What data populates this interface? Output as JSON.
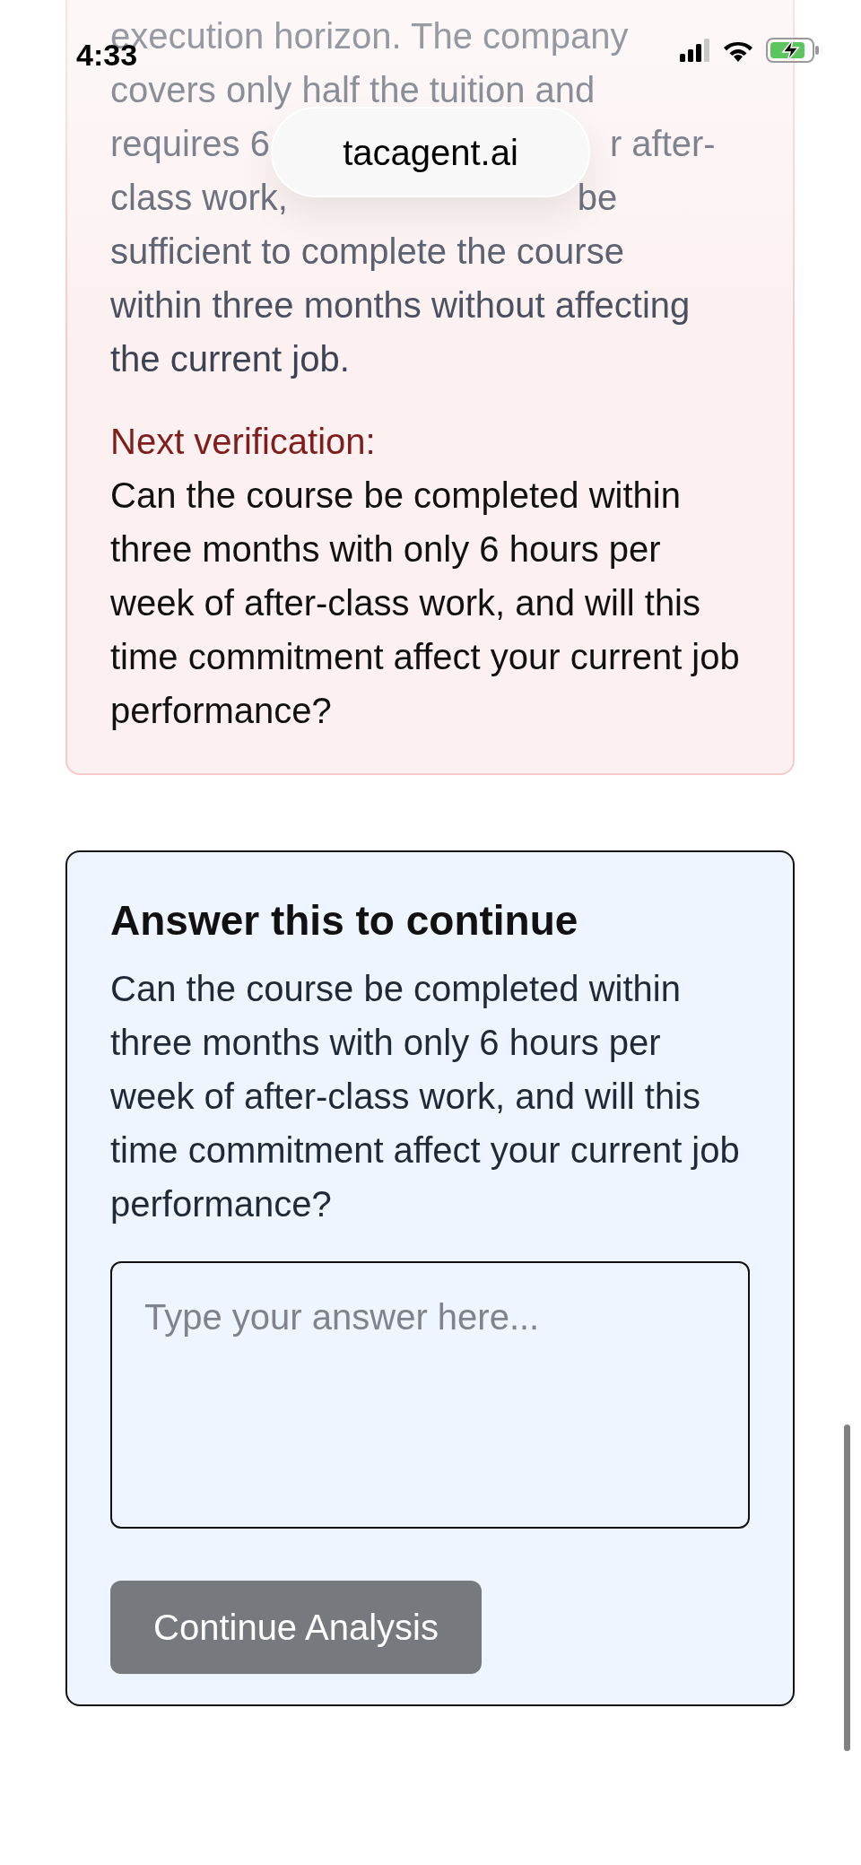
{
  "status_bar": {
    "time": "4:33"
  },
  "address_bar": {
    "url": "tacagent.ai"
  },
  "assessment_card": {
    "text_lines": [
      [
        "execution horizon. The company"
      ],
      [
        "covers only half the tuition and"
      ],
      [
        "requires 6",
        "r after-"
      ],
      [
        "class work,",
        "be"
      ],
      [
        "sufficient to complete the course"
      ],
      [
        "within three months without affecting"
      ],
      [
        "the current job."
      ]
    ],
    "next_label": "Next verification:",
    "next_question": "Can the course be completed within three months with only 6 hours per week of after-class work, and will this time commitment affect your current job performance?"
  },
  "answer_card": {
    "heading": "Answer this to continue",
    "question": "Can the course be completed within three months with only 6 hours per week of after-class work, and will this time commitment affect your current job performance?",
    "answer": {
      "placeholder": "Type your answer here..."
    },
    "submit_button": {
      "label": "Continue Analysis",
      "disabled": true
    }
  }
}
